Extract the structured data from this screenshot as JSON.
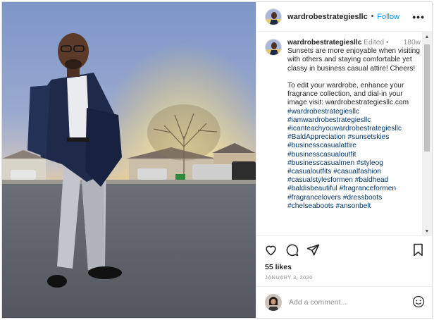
{
  "post": {
    "username": "wardrobestrategiesllc",
    "follow_label": "Follow",
    "more_label": "•••",
    "separator": "•",
    "caption": {
      "username": "wardrobestrategiesllc",
      "edited_label": "Edited",
      "separator": "•",
      "time": "180w",
      "text": "Sunsets are more enjoyable when visiting with others and staying comfortable yet classy in business casual attire! Cheers!\n\nTo edit your wardrobe, enhance your fragrance collection, and dial-in your image visit: wardrobestrategiesllc.com",
      "hashtags": [
        "#wardrobestrategiesllc",
        "#iamwardrobestrategiesllc",
        "#icanteachyouwardrobestrategiesllc",
        "#BaldAppreciation #sunsetskies",
        "#businesscasualattire",
        "#businesscasualoutfit",
        "#businesscasualmen #styleog",
        "#casualoutfits #casualfashion",
        "#casualstylesformen #baldhead",
        "#baldisbeautiful #fragranceformen",
        "#fragrancelovers #dressboots",
        "#chelseaboots #ansonbelt"
      ]
    },
    "likes": "55 likes",
    "date": "JANUARY 3, 2020",
    "comment_placeholder": "Add a comment...",
    "icons": [
      "heart-icon",
      "comment-icon",
      "share-icon",
      "bookmark-icon",
      "emoji-icon",
      "more-icon"
    ]
  },
  "colors": {
    "link": "#00376b",
    "follow": "#0095f6",
    "muted": "#8e8e8e"
  }
}
